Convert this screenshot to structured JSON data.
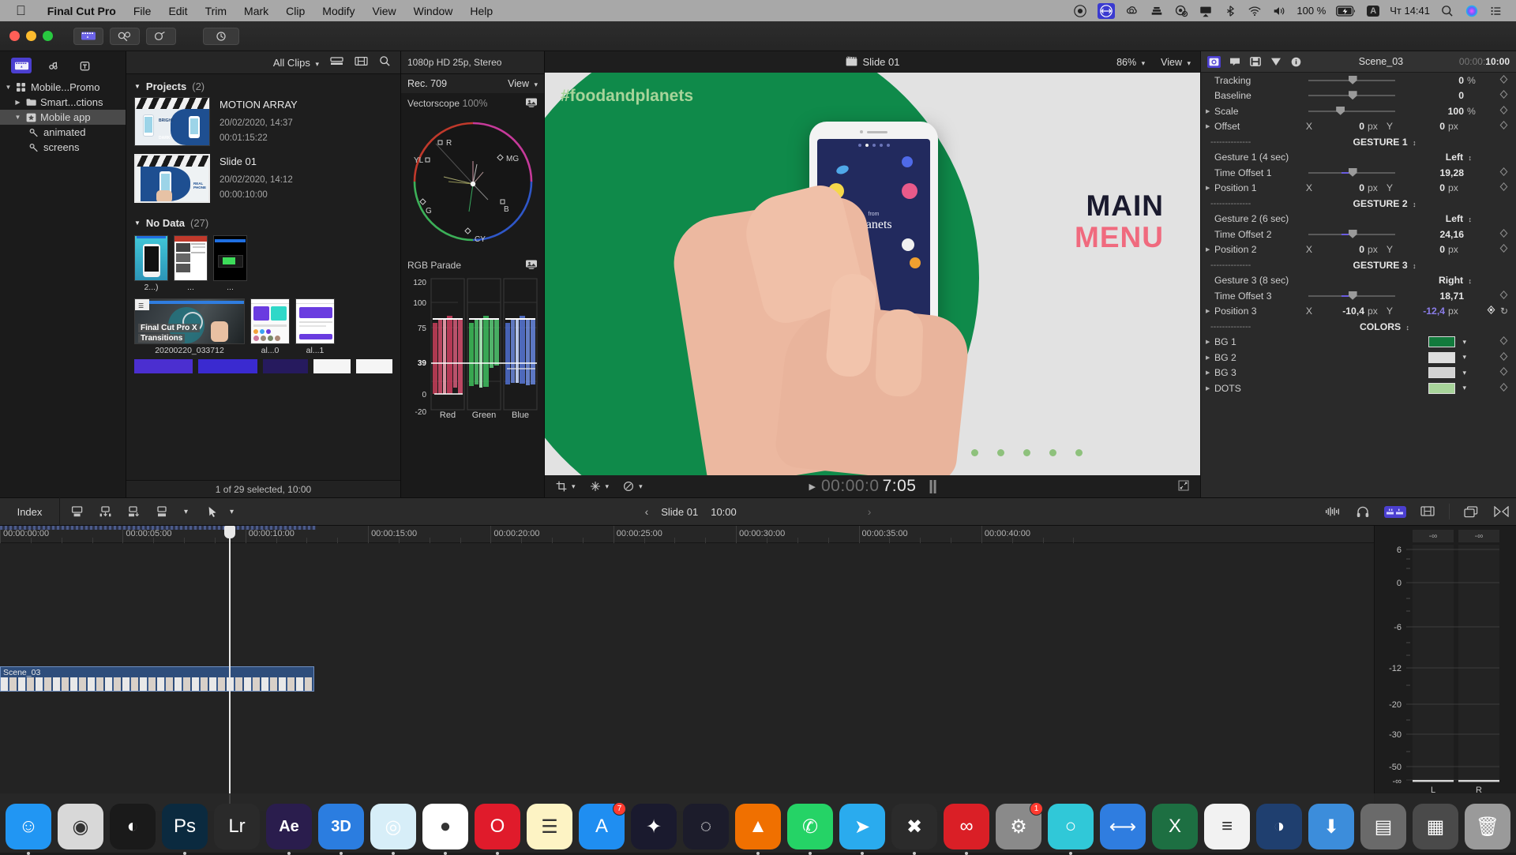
{
  "menubar": {
    "apple_icon": "apple-icon",
    "items": [
      "Final Cut Pro",
      "File",
      "Edit",
      "Trim",
      "Mark",
      "Clip",
      "Modify",
      "View",
      "Window",
      "Help"
    ],
    "status_icons": [
      "record-icon",
      "display-arrows-icon",
      "creative-cloud-icon",
      "stacks-icon",
      "cleanshot-icon",
      "airplay-icon",
      "bluetooth-icon",
      "wifi-icon",
      "volume-icon"
    ],
    "battery_percent": "100 %",
    "battery_icon": "battery-charging-icon",
    "input_source": "A",
    "clock": "Чт 14:41",
    "search_icon": "search-icon",
    "siri_icon": "siri-icon",
    "control_center_icon": "control-center-icon"
  },
  "toolbar": {
    "window_buttons": [
      "close-button",
      "minimize-button",
      "zoom-button"
    ],
    "import_icon": "import-media-icon",
    "keyword_icon": "keyword-editor-icon",
    "color_icon": "color-mask-icon"
  },
  "sidebar": {
    "tabs": [
      {
        "name": "libraries-tab",
        "icon": "film-clapper-icon",
        "active": true
      },
      {
        "name": "photos-audio-tab",
        "icon": "photos-audio-icon",
        "active": false
      },
      {
        "name": "titles-generators-tab",
        "icon": "titles-generators-icon",
        "active": false
      }
    ],
    "items": [
      {
        "label": "Mobile...Promo",
        "icon": "library-icon",
        "indent": 0,
        "disclosure": "down",
        "selected": false
      },
      {
        "label": "Smart...ctions",
        "icon": "folder-icon",
        "indent": 1,
        "disclosure": "right",
        "selected": false
      },
      {
        "label": "Mobile app",
        "icon": "event-star-icon",
        "indent": 1,
        "disclosure": "down",
        "selected": true
      },
      {
        "label": "animated",
        "icon": "keyword-icon",
        "indent": 2,
        "disclosure": "none",
        "selected": false
      },
      {
        "label": "screens",
        "icon": "keyword-icon",
        "indent": 2,
        "disclosure": "none",
        "selected": false
      }
    ]
  },
  "browser": {
    "filter_label": "All Clips",
    "list_view_icon": "list-view-icon",
    "filmstrip_view_icon": "filmstrip-view-icon",
    "search_icon": "search-icon",
    "groups": [
      {
        "title": "Projects",
        "count": "(2)",
        "projects": [
          {
            "name": "MOTION ARRAY",
            "date": "20/02/2020, 14:37",
            "duration": "00:01:15:22",
            "selected": false
          },
          {
            "name": "Slide 01",
            "date": "20/02/2020, 14:12",
            "duration": "00:00:10:00",
            "selected": true
          }
        ]
      },
      {
        "title": "No Data",
        "count": "(27)",
        "clips_row1": [
          {
            "label": "2...)"
          },
          {
            "label": "..."
          },
          {
            "label": "..."
          }
        ],
        "clips_row2": [
          {
            "label": "20200220_033712",
            "overlay_line1": "Final Cut Pro X",
            "overlay_line2": "Transitions"
          },
          {
            "label": "al...0"
          },
          {
            "label": "al...1"
          }
        ]
      }
    ],
    "status": "1 of 29 selected, 10:00"
  },
  "scopes": {
    "format_info": "1080p HD 25p, Stereo",
    "colorspace": "Rec. 709",
    "view_label": "View",
    "vectorscope": {
      "title": "Vectorscope",
      "scale": "100%",
      "targets": [
        "R",
        "MG",
        "B",
        "CY",
        "G",
        "YL"
      ],
      "settings_icon": "scope-settings-icon"
    },
    "rgb_parade": {
      "title": "RGB Parade",
      "settings_icon": "scope-settings-icon",
      "y_ticks": [
        "120",
        "100",
        "75",
        "39",
        "0",
        "-20"
      ],
      "highlight_tick": "39",
      "channels": [
        "Red",
        "Green",
        "Blue"
      ]
    }
  },
  "viewer": {
    "project_icon": "film-clapper-icon",
    "title": "Slide 01",
    "zoom": "86%",
    "view_label": "View",
    "crop_icon": "crop-icon",
    "transform_icon": "transform-icon",
    "retime_icon": "retime-icon",
    "play_icon": "play-icon",
    "timecode_dim": "00:00:0",
    "timecode_bright": "7:05",
    "fullscreen_icon": "fullscreen-icon",
    "canvas": {
      "hashtag": "#foodandplanets",
      "headline_top": "MAIN",
      "headline_bottom": "MENU",
      "phone_title_small": "from",
      "phone_title": "Planets",
      "bg_green": "#0f8a4a",
      "bg_light": "#e2e2e2",
      "phone_screen": "#222a5e",
      "accent_pink": "#f06a7e"
    }
  },
  "inspector": {
    "tabs": [
      {
        "name": "video-inspector-tab",
        "icon": "video-icon",
        "active": true
      },
      {
        "name": "title-inspector-tab",
        "icon": "title-icon",
        "active": false
      },
      {
        "name": "generator-inspector-tab",
        "icon": "generator-icon",
        "active": false
      },
      {
        "name": "color-inspector-tab",
        "icon": "color-triangle-icon",
        "active": false
      },
      {
        "name": "info-inspector-tab",
        "icon": "info-icon",
        "active": false
      }
    ],
    "clip_name": "Scene_03",
    "timecode_dim": "00:00:",
    "timecode_bright": "10:00",
    "rows": [
      {
        "kind": "slider",
        "name": "Tracking",
        "value": "0",
        "unit": "%",
        "knob": 46,
        "disclosure": false,
        "fill": false
      },
      {
        "kind": "slider",
        "name": "Baseline",
        "value": "0",
        "unit": "",
        "knob": 46,
        "disclosure": false,
        "fill": false
      },
      {
        "kind": "slider",
        "name": "Scale",
        "value": "100",
        "unit": "%",
        "knob": 32,
        "disclosure": true,
        "fill": false
      },
      {
        "kind": "xy",
        "name": "Offset",
        "x_label": "X",
        "x_value": "0",
        "y_label": "Y",
        "y_value": "0",
        "unit": "px",
        "disclosure": true
      },
      {
        "kind": "separator",
        "dashes": "--------------",
        "popup": "GESTURE 1"
      },
      {
        "kind": "popup",
        "name": "Gesture 1 (4 sec)",
        "value": "Left"
      },
      {
        "kind": "slider",
        "name": "Time Offset 1",
        "value": "19,28",
        "unit": "",
        "knob": 46,
        "disclosure": false,
        "fill": true
      },
      {
        "kind": "xy",
        "name": "Position 1",
        "x_label": "X",
        "x_value": "0",
        "y_label": "Y",
        "y_value": "0",
        "unit": "px",
        "disclosure": true
      },
      {
        "kind": "separator",
        "dashes": "--------------",
        "popup": "GESTURE 2"
      },
      {
        "kind": "popup",
        "name": "Gesture 2 (6 sec)",
        "value": "Left"
      },
      {
        "kind": "slider",
        "name": "Time Offset 2",
        "value": "24,16",
        "unit": "",
        "knob": 46,
        "disclosure": false,
        "fill": true
      },
      {
        "kind": "xy",
        "name": "Position 2",
        "x_label": "X",
        "x_value": "0",
        "y_label": "Y",
        "y_value": "0",
        "unit": "px",
        "disclosure": true
      },
      {
        "kind": "separator",
        "dashes": "--------------",
        "popup": "GESTURE 3"
      },
      {
        "kind": "popup",
        "name": "Gesture 3 (8 sec)",
        "value": "Right"
      },
      {
        "kind": "slider",
        "name": "Time Offset 3",
        "value": "18,71",
        "unit": "",
        "knob": 46,
        "disclosure": false,
        "fill": true
      },
      {
        "kind": "xy_active",
        "name": "Position 3",
        "x_label": "X",
        "x_value": "-10,4",
        "y_label": "Y",
        "y_value": "-12,4",
        "unit": "px",
        "disclosure": true
      },
      {
        "kind": "separator",
        "dashes": "--------------",
        "popup": "COLORS"
      },
      {
        "kind": "color",
        "name": "BG 1",
        "color": "#127a3c",
        "disclosure": true
      },
      {
        "kind": "color",
        "name": "BG 2",
        "color": "#dedede",
        "disclosure": true
      },
      {
        "kind": "color",
        "name": "BG 3",
        "color": "#d2d2d2",
        "disclosure": true
      },
      {
        "kind": "color",
        "name": "DOTS",
        "color": "#a8d49a",
        "disclosure": true
      }
    ]
  },
  "timeline": {
    "index_label": "Index",
    "tool_icons": [
      "append-icon",
      "insert-icon",
      "overwrite-icon",
      "connect-icon"
    ],
    "tool_dropdown_icon": "chevron-down-icon",
    "select-tool_icon": "arrow-select-icon",
    "prev_icon": "chevron-left-icon",
    "next_icon": "chevron-right-icon",
    "project_name": "Slide 01",
    "project_duration": "10:00",
    "right_icons": [
      "audio-skimming-icon",
      "solo-icon",
      "audio-meters-icon",
      "filmstrip-appearance-icon",
      "window-arrange-icon",
      "effects-browser-icon"
    ],
    "ruler_labels": [
      "00:00:00:00",
      "00:00:05:00",
      "00:00:10:00",
      "00:00:15:00",
      "00:00:20:00",
      "00:00:25:00",
      "00:00:30:00",
      "00:00:35:00",
      "00:00:40:00"
    ],
    "playhead_time": "00:00:05:00",
    "clip": {
      "name": "Scene_03",
      "color": "#2e4d7b"
    }
  },
  "meters": {
    "left_peak": "-∞",
    "right_peak": "-∞",
    "scale": [
      "6",
      "0",
      "-6",
      "-12",
      "-20",
      "-30",
      "-50",
      "-∞"
    ],
    "channels": [
      "L",
      "R"
    ]
  },
  "dock": {
    "apps": [
      {
        "name": "finder",
        "label": "",
        "bg": "#2196f3",
        "glyph": "☺",
        "running": true
      },
      {
        "name": "launchpad",
        "label": "",
        "bg": "#d8d8d8",
        "glyph": "◉",
        "running": false
      },
      {
        "name": "color-app",
        "label": "",
        "bg": "#1a1a1a",
        "glyph": "◐",
        "running": false
      },
      {
        "name": "photoshop",
        "label": "",
        "bg": "#0b2a3f",
        "glyph": "Ps",
        "running": true
      },
      {
        "name": "lightroom",
        "label": "",
        "bg": "#2a2a2a",
        "glyph": "Lr",
        "running": false
      },
      {
        "name": "after-effects",
        "label": "Ae",
        "bg": "#2a1d4d",
        "glyph": "Ae",
        "running": true
      },
      {
        "name": "cinema-3d",
        "label": "3D",
        "bg": "#2b7de0",
        "glyph": "3D",
        "running": true
      },
      {
        "name": "safari",
        "label": "",
        "bg": "#d7eef8",
        "glyph": "◎",
        "running": true
      },
      {
        "name": "chrome",
        "label": "",
        "bg": "#ffffff",
        "glyph": "●",
        "running": true
      },
      {
        "name": "opera",
        "label": "",
        "bg": "#e01b2b",
        "glyph": "O",
        "running": true
      },
      {
        "name": "notes",
        "label": "",
        "bg": "#fdf3c4",
        "glyph": "☰",
        "running": false
      },
      {
        "name": "app-store",
        "label": "",
        "bg": "#1f8ef1",
        "glyph": "A",
        "running": false,
        "badge": "7"
      },
      {
        "name": "mission-control",
        "label": "",
        "bg": "#1a1a2e",
        "glyph": "✦",
        "running": false
      },
      {
        "name": "curves-app",
        "label": "",
        "bg": "#1c1c2b",
        "glyph": "◌",
        "running": false
      },
      {
        "name": "vlc",
        "label": "",
        "bg": "#f07000",
        "glyph": "▲",
        "running": true
      },
      {
        "name": "whatsapp",
        "label": "",
        "bg": "#25d366",
        "glyph": "✆",
        "running": true
      },
      {
        "name": "telegram",
        "label": "",
        "bg": "#2aabee",
        "glyph": "➤",
        "running": true
      },
      {
        "name": "x-app",
        "label": "",
        "bg": "#2b2b2b",
        "glyph": "✖",
        "running": true
      },
      {
        "name": "creative-cloud",
        "label": "",
        "bg": "#da1f26",
        "glyph": "∞",
        "running": true
      },
      {
        "name": "system-preferences",
        "label": "",
        "bg": "#8a8a8a",
        "glyph": "⚙",
        "running": false,
        "badge": "1"
      },
      {
        "name": "screen-capture",
        "label": "",
        "bg": "#30c8d8",
        "glyph": "○",
        "running": true
      },
      {
        "name": "transmit",
        "label": "",
        "bg": "#2f7de0",
        "glyph": "⟷",
        "running": false
      },
      {
        "name": "excel",
        "label": "",
        "bg": "#1d6f42",
        "glyph": "X",
        "running": false
      },
      {
        "name": "text-editor",
        "label": "",
        "bg": "#f2f2f2",
        "glyph": "≡",
        "running": false
      },
      {
        "name": "preview-app",
        "label": "",
        "bg": "#1f3f6f",
        "glyph": "◑",
        "running": false
      },
      {
        "name": "downloads-folder",
        "label": "",
        "bg": "#3c8ddb",
        "glyph": "⬇",
        "running": false
      },
      {
        "name": "documents-folder",
        "label": "",
        "bg": "#6a6a6a",
        "glyph": "▤",
        "running": false
      },
      {
        "name": "screenshots-folder",
        "label": "",
        "bg": "#4a4a4a",
        "glyph": "▦",
        "running": false
      },
      {
        "name": "trash",
        "label": "",
        "bg": "#9a9a9a",
        "glyph": "🗑",
        "running": false
      }
    ]
  }
}
